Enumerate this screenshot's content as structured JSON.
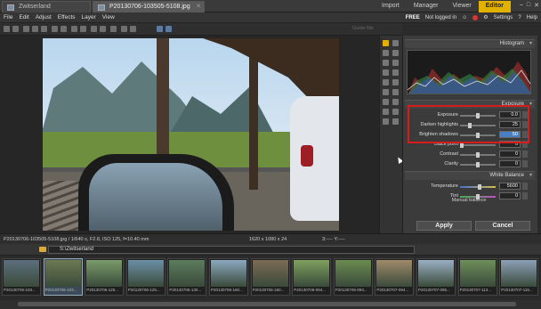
{
  "tabs": [
    {
      "label": "Zwitserland"
    },
    {
      "label": "P20130706-103505-5108.jpg"
    }
  ],
  "modes": [
    "Import",
    "Manager",
    "Viewer",
    "Editor"
  ],
  "active_mode": "Editor",
  "menu": [
    "File",
    "Edit",
    "Adjust",
    "Effects",
    "Layer",
    "View"
  ],
  "menu_right": {
    "free": "FREE",
    "login": "Not logged in",
    "settings": "Settings",
    "help": "Help"
  },
  "toolbar": {
    "guide_label": "Guide Me"
  },
  "panels": {
    "histogram": "Histogram",
    "exposure": "Exposure",
    "white_balance": "White Balance"
  },
  "exposure": [
    {
      "label": "Exposure",
      "value": "0.0",
      "level": 0.5
    },
    {
      "label": "Darken highlights",
      "value": "25",
      "level": 0.25
    },
    {
      "label": "Brighten shadows",
      "value": "50",
      "level": 0.5
    },
    {
      "label": "Black point",
      "value": "0",
      "level": 0.0
    },
    {
      "label": "Contrast",
      "value": "0",
      "level": 0.5
    },
    {
      "label": "Clarity",
      "value": "0",
      "level": 0.5
    }
  ],
  "white_balance": [
    {
      "label": "Temperature",
      "value": "5600",
      "level": 0.55
    },
    {
      "label": "Tint",
      "value": "0",
      "level": 0.5
    }
  ],
  "manual_balance": "Manual balance",
  "buttons": {
    "apply": "Apply",
    "cancel": "Cancel"
  },
  "status": {
    "info": "P20130706-103505-5108.jpg / 1/640 s, F2.8, ISO 125, f=10.40 mm",
    "dims": "1620 x 1080 x 24",
    "coord": "3:----  Y:----"
  },
  "path": "S:\\Zwitserland",
  "thumbnails": [
    {
      "name": "P20130706-103...",
      "color": "#5d6f7e"
    },
    {
      "name": "P20130706-103...",
      "color": "#6c7a52",
      "selected": true
    },
    {
      "name": "P20130706-125...",
      "color": "#7a9c6a"
    },
    {
      "name": "P20130706-125...",
      "color": "#6c90a8"
    },
    {
      "name": "P20130706-130...",
      "color": "#5b7d5d"
    },
    {
      "name": "P20130706-160...",
      "color": "#8aa8c0"
    },
    {
      "name": "P20130706-160...",
      "color": "#7c6b55"
    },
    {
      "name": "P20130706-094...",
      "color": "#80a060"
    },
    {
      "name": "P20130706-094...",
      "color": "#6a8c50"
    },
    {
      "name": "P20130707-094...",
      "color": "#a08a6a"
    },
    {
      "name": "P20130707-095...",
      "color": "#9ab0c4"
    },
    {
      "name": "P20130707-113...",
      "color": "#6e8e5a"
    },
    {
      "name": "P20130707-115...",
      "color": "#8ba0b8"
    }
  ]
}
